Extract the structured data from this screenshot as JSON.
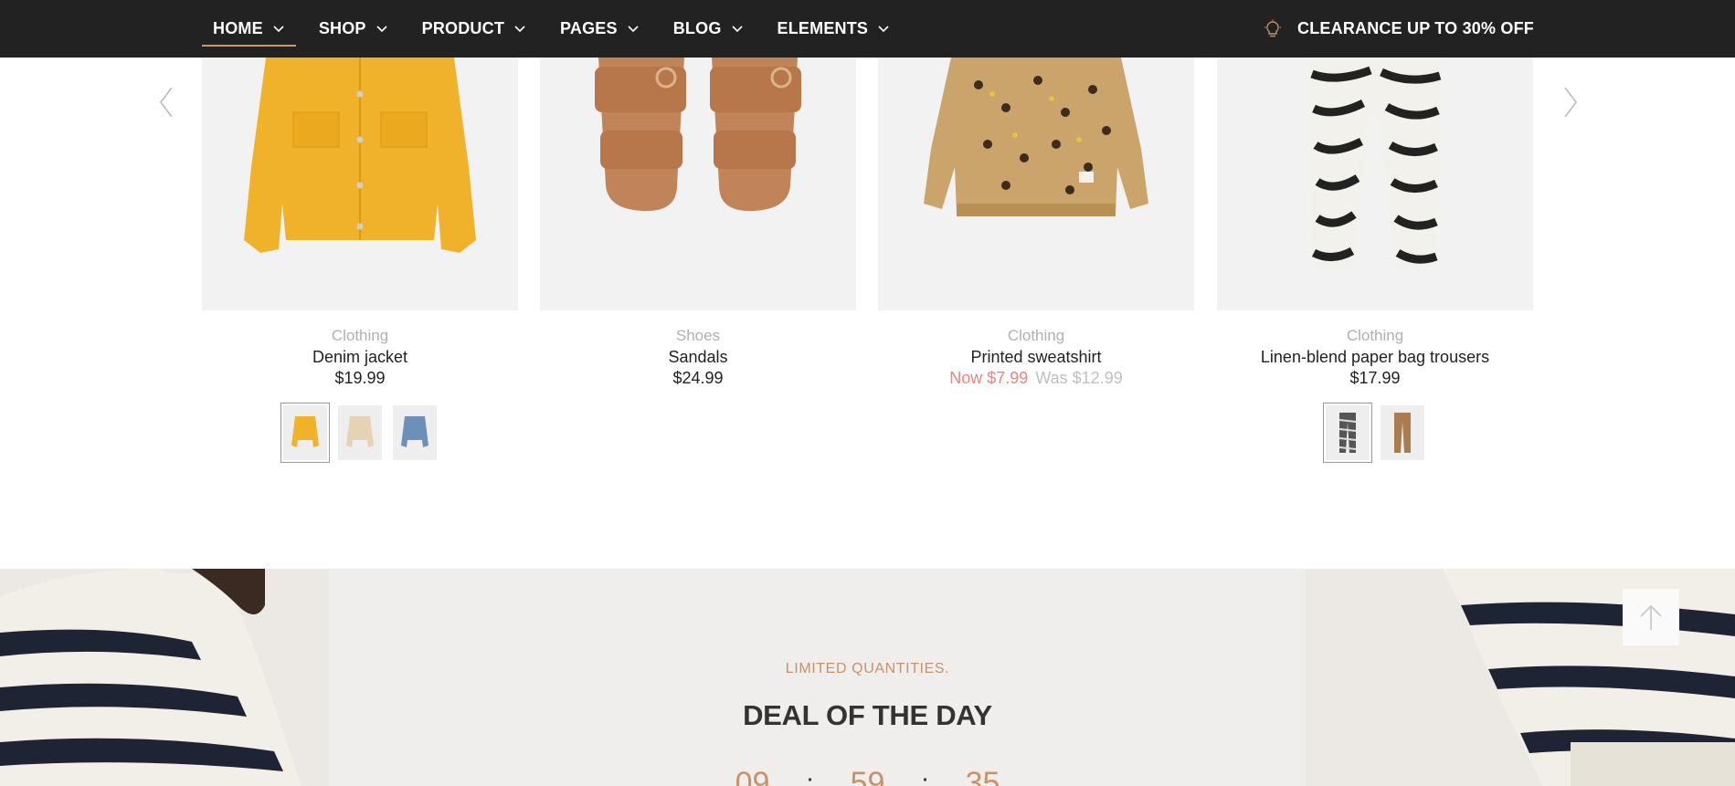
{
  "nav": {
    "items": [
      {
        "label": "HOME"
      },
      {
        "label": "SHOP"
      },
      {
        "label": "PRODUCT"
      },
      {
        "label": "PAGES"
      },
      {
        "label": "BLOG"
      },
      {
        "label": "ELEMENTS"
      }
    ],
    "promo": "CLEARANCE UP TO 30% OFF"
  },
  "products": [
    {
      "category": "Clothing",
      "name": "Denim jacket",
      "price": "$19.99",
      "swatches": [
        "yellow",
        "beige",
        "blue"
      ]
    },
    {
      "category": "Shoes",
      "name": "Sandals",
      "price": "$24.99"
    },
    {
      "category": "Clothing",
      "name": "Printed sweatshirt",
      "price_now": "Now $7.99",
      "price_was": "Was $12.99"
    },
    {
      "category": "Clothing",
      "name": "Linen-blend paper bag trousers",
      "price": "$17.99",
      "swatches": [
        "zebra",
        "brown"
      ]
    }
  ],
  "deal": {
    "kicker": "LIMITED QUANTITIES.",
    "title": "DEAL OF THE DAY",
    "countdown": [
      "09",
      "59",
      "35"
    ],
    "separator": ":"
  },
  "colors": {
    "nav_bg": "#222222",
    "accent": "#c8916a",
    "sale": "#ef837b",
    "card_bg": "#f3f2f2",
    "deal_bg": "#efeeec"
  },
  "icons": [
    "chevron-down-icon",
    "lightbulb-icon",
    "chevron-left-icon",
    "chevron-right-icon",
    "arrow-up-icon"
  ]
}
